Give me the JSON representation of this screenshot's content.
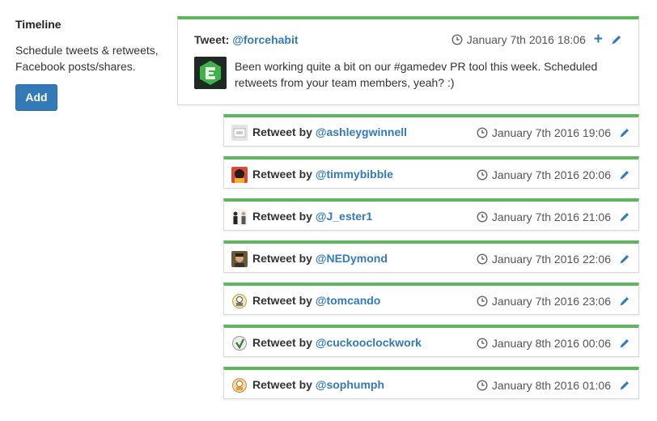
{
  "sidebar": {
    "title": "Timeline",
    "description": "Schedule tweets & retweets, Facebook posts/shares.",
    "add_label": "Add"
  },
  "tweet": {
    "label": "Tweet:",
    "handle": "@forcehabit",
    "time": "January 7th 2016 18:06",
    "text": "Been working quite a bit on our #gamedev PR tool this week. Scheduled retweets from your team members, yeah? :)"
  },
  "retweets": [
    {
      "label": "Retweet by",
      "handle": "@ashleygwinnell",
      "time": "January 7th 2016 19:06"
    },
    {
      "label": "Retweet by",
      "handle": "@timmybibble",
      "time": "January 7th 2016 20:06"
    },
    {
      "label": "Retweet by",
      "handle": "@J_ester1",
      "time": "January 7th 2016 21:06"
    },
    {
      "label": "Retweet by",
      "handle": "@NEDymond",
      "time": "January 7th 2016 22:06"
    },
    {
      "label": "Retweet by",
      "handle": "@tomcando",
      "time": "January 7th 2016 23:06"
    },
    {
      "label": "Retweet by",
      "handle": "@cuckooclockwork",
      "time": "January 8th 2016 00:06"
    },
    {
      "label": "Retweet by",
      "handle": "@sophumph",
      "time": "January 8th 2016 01:06"
    }
  ],
  "colors": {
    "accent": "#337ab7",
    "status_bar": "#5cb85c"
  }
}
